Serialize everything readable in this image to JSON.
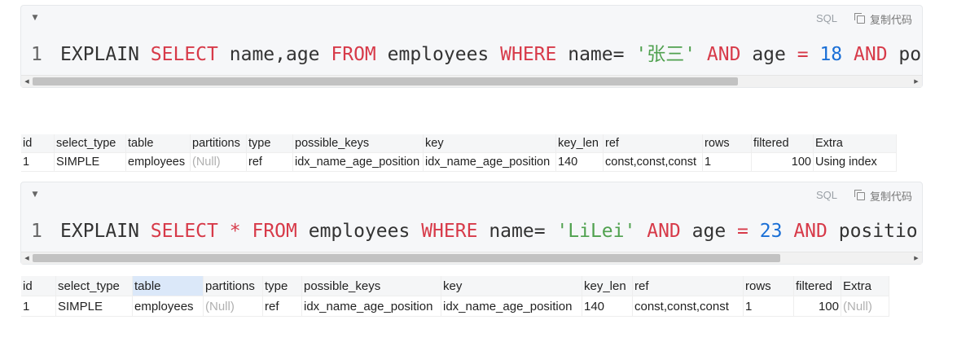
{
  "code_block_1": {
    "language": "SQL",
    "copy_label": "复制代码",
    "line_number": "1",
    "tokens": [
      "EXPLAIN",
      "SELECT",
      "name,age",
      "FROM",
      "employees",
      "WHERE",
      "name=",
      "'张三'",
      "AND",
      "age",
      "=",
      "18",
      "AND",
      "po"
    ]
  },
  "table_1": {
    "headers": [
      "id",
      "select_type",
      "table",
      "partitions",
      "type",
      "possible_keys",
      "key",
      "key_len",
      "ref",
      "rows",
      "filtered",
      "Extra"
    ],
    "row": [
      "1",
      "SIMPLE",
      "employees",
      "(Null)",
      "ref",
      "idx_name_age_position",
      "idx_name_age_position",
      "140",
      "const,const,const",
      "1",
      "100",
      "Using index"
    ]
  },
  "code_block_2": {
    "language": "SQL",
    "copy_label": "复制代码",
    "line_number": "1",
    "tokens": [
      "EXPLAIN",
      "SELECT",
      "*",
      "FROM",
      "employees",
      "WHERE",
      "name=",
      "'LiLei'",
      "AND",
      "age",
      "=",
      "23",
      "AND",
      "positio"
    ]
  },
  "table_2": {
    "headers": [
      "id",
      "select_type",
      "table",
      "partitions",
      "type",
      "possible_keys",
      "key",
      "key_len",
      "ref",
      "rows",
      "filtered",
      "Extra"
    ],
    "row": [
      "1",
      "SIMPLE",
      "employees",
      "(Null)",
      "ref",
      "idx_name_age_position",
      "idx_name_age_position",
      "140",
      "const,const,const",
      "1",
      "100",
      "(Null)"
    ]
  },
  "icons": {
    "toggle": "chevron-down-icon",
    "copy": "copy-icon",
    "scroll_left": "arrow-left-icon",
    "scroll_right": "arrow-right-icon"
  },
  "colors": {
    "keyword": "#d73a49",
    "string": "#50a14f",
    "number": "#1a6fd6",
    "null_text": "#b0b0b0",
    "selected_header": "#dbe8f9"
  }
}
